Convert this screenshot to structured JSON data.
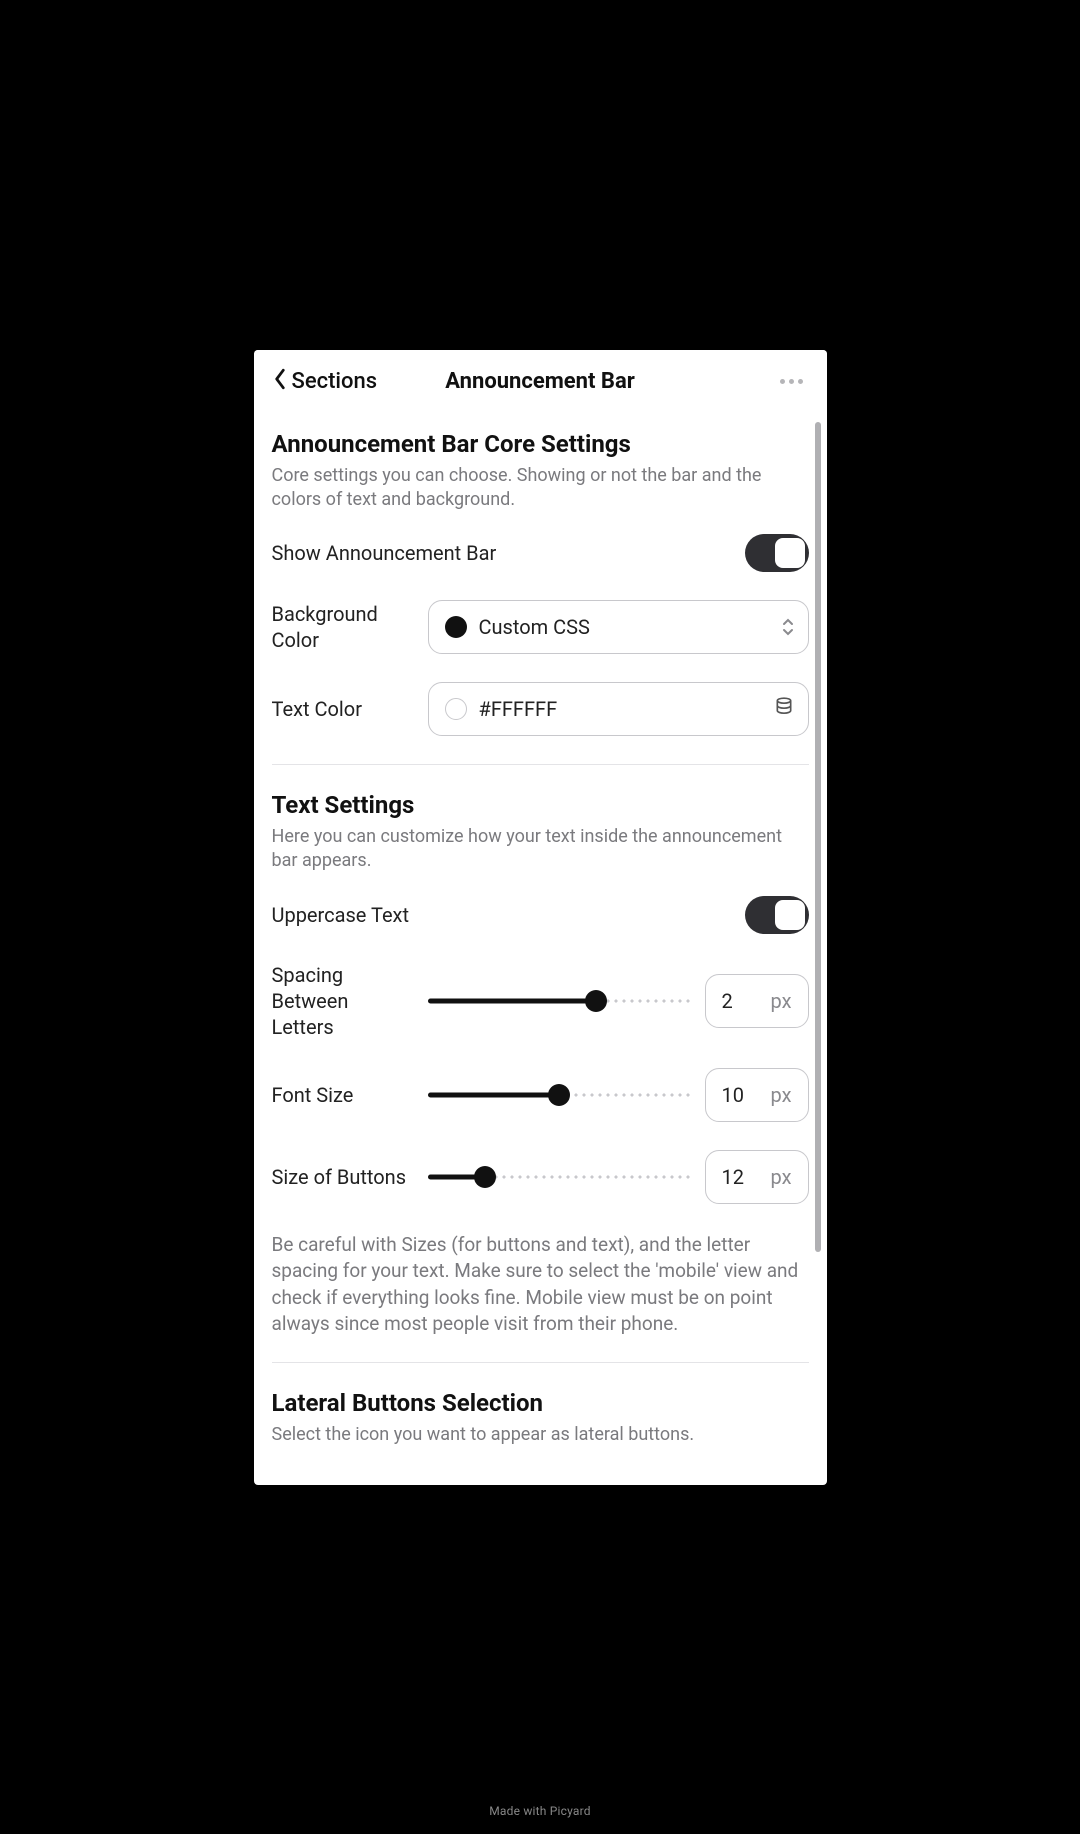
{
  "header": {
    "back_label": "Sections",
    "title": "Announcement Bar"
  },
  "core": {
    "heading": "Announcement Bar Core Settings",
    "desc": "Core settings you can choose. Showing or not the bar and the colors of text and background.",
    "show_label": "Show Announcement Bar",
    "show_value": true,
    "bg_label": "Background Color",
    "bg_value": "Custom CSS",
    "bg_swatch": "#000000",
    "text_label": "Text Color",
    "text_value": "#FFFFFF",
    "text_swatch": "#FFFFFF"
  },
  "text_settings": {
    "heading": "Text Settings",
    "desc": "Here you can customize how your text inside the announcement bar appears.",
    "uppercase_label": "Uppercase Text",
    "uppercase_value": true,
    "spacing_label": "Spacing Between Letters",
    "spacing_value": "2",
    "spacing_unit": "px",
    "spacing_pct": 64,
    "fontsize_label": "Font Size",
    "fontsize_value": "10",
    "fontsize_unit": "px",
    "fontsize_pct": 50,
    "btnsize_label": "Size of Buttons",
    "btnsize_value": "12",
    "btnsize_unit": "px",
    "btnsize_pct": 22,
    "note": "Be careful with Sizes (for buttons and text), and the letter spacing for your text. Make sure to select the 'mobile' view and check if everything looks fine. Mobile view must be on point always since most people visit from their phone."
  },
  "lateral": {
    "heading": "Lateral Buttons Selection",
    "desc": "Select the icon you want to appear as lateral buttons."
  },
  "watermark": "Made with Picyard"
}
